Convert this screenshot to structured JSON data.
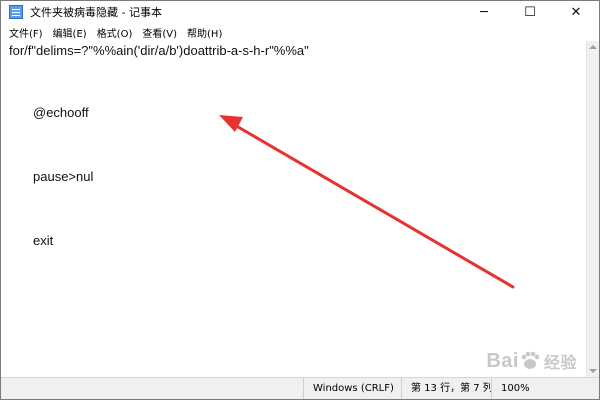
{
  "window": {
    "title": "文件夹被病毒隐藏 - 记事本",
    "controls": {
      "minimize": "─",
      "maximize": "☐",
      "close": "✕"
    }
  },
  "menu": [
    "文件(F)",
    "编辑(E)",
    "格式(O)",
    "查看(V)",
    "帮助(H)"
  ],
  "editor": {
    "lines": [
      "for/f\"delims=?\"%%ain('dir/a/b')doattrib-a-s-h-r\"%%a\"",
      "@echooff",
      "pause>nul",
      "exit"
    ]
  },
  "statusbar": {
    "encoding": "Windows (CRLF)",
    "position": "第 13 行，第 7 列",
    "zoom": "100%"
  },
  "watermark": {
    "text": "Bai",
    "suffix": "经验"
  },
  "colors": {
    "arrow": "#e8322f"
  },
  "icons": {
    "app": "notepad-icon",
    "watermark": "baidu-paw-icon"
  }
}
